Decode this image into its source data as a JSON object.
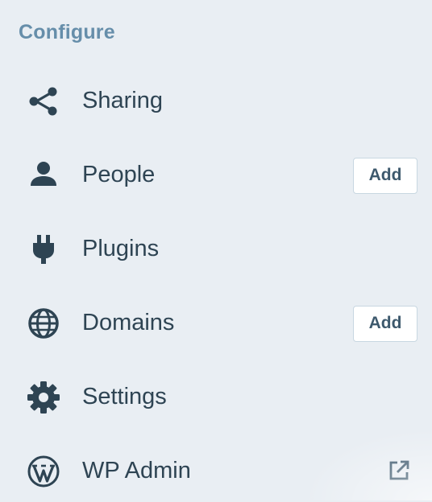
{
  "section": {
    "title": "Configure"
  },
  "items": [
    {
      "label": "Sharing",
      "icon": "share-icon"
    },
    {
      "label": "People",
      "icon": "person-icon",
      "action": "Add"
    },
    {
      "label": "Plugins",
      "icon": "plug-icon"
    },
    {
      "label": "Domains",
      "icon": "globe-icon",
      "action": "Add"
    },
    {
      "label": "Settings",
      "icon": "gear-icon"
    },
    {
      "label": "WP Admin",
      "icon": "wordpress-icon",
      "trailing_icon": "external-link-icon"
    }
  ],
  "colors": {
    "background": "#e9eef3",
    "section_title": "#668eaa",
    "text": "#2e4453",
    "button_border": "#c8d7e1"
  }
}
